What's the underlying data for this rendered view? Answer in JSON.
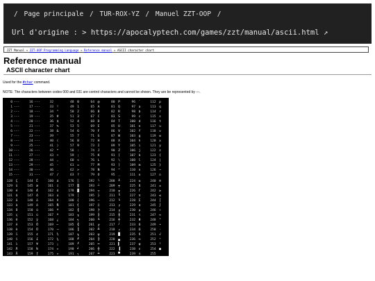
{
  "topbar": {
    "home": "Page principale",
    "sep": "/",
    "site": "TUR-ROX-YZ",
    "manual": "Manuel ZZT-OOP",
    "url_label": "Url d'origine :",
    "url_arrow": ">",
    "url": "https://apocalyptech.com/games/zzt/manual/ascii.html",
    "external_icon": "↗"
  },
  "breadcrumb": {
    "root": "ZZT Manual",
    "sep": "»",
    "lang": "ZZT-OOP Programming Language",
    "ref": "Reference manual",
    "current": "ASCII character chart"
  },
  "header": {
    "title": "Reference manual",
    "subtitle": "ASCII character chart"
  },
  "used": {
    "prefix": "Used for the",
    "command": "#char",
    "suffix": "command."
  },
  "note": "NOTE: The characters between codes 000 and 031 are control characters and cannot be shown. They are be represented by ---.",
  "chart": {
    "block1_columns": [
      [
        [
          "0",
          "---"
        ],
        [
          "1",
          "---"
        ],
        [
          "2",
          "---"
        ],
        [
          "3",
          "---"
        ],
        [
          "4",
          "---"
        ],
        [
          "5",
          "---"
        ],
        [
          "6",
          "---"
        ],
        [
          "7",
          "---"
        ],
        [
          "8",
          "---"
        ],
        [
          "9",
          "---"
        ],
        [
          "10",
          "---"
        ],
        [
          "11",
          "---"
        ],
        [
          "12",
          "---"
        ],
        [
          "13",
          "---"
        ],
        [
          "14",
          "---"
        ],
        [
          "15",
          "---"
        ]
      ],
      [
        [
          "16",
          "---"
        ],
        [
          "17",
          "---"
        ],
        [
          "18",
          "---"
        ],
        [
          "19",
          "---"
        ],
        [
          "20",
          "---"
        ],
        [
          "21",
          "---"
        ],
        [
          "22",
          "---"
        ],
        [
          "23",
          "---"
        ],
        [
          "24",
          "---"
        ],
        [
          "25",
          "---"
        ],
        [
          "26",
          "---"
        ],
        [
          "27",
          "---"
        ],
        [
          "28",
          "---"
        ],
        [
          "29",
          "---"
        ],
        [
          "30",
          "---"
        ],
        [
          "31",
          "---"
        ]
      ],
      [
        [
          "32",
          " "
        ],
        [
          "33",
          "!"
        ],
        [
          "34",
          "\""
        ],
        [
          "35",
          "#"
        ],
        [
          "36",
          "$"
        ],
        [
          "37",
          "%"
        ],
        [
          "38",
          "&"
        ],
        [
          "39",
          "'"
        ],
        [
          "40",
          "("
        ],
        [
          "41",
          ")"
        ],
        [
          "42",
          "*"
        ],
        [
          "43",
          "+"
        ],
        [
          "44",
          ","
        ],
        [
          "45",
          "-"
        ],
        [
          "46",
          "."
        ],
        [
          "47",
          "/"
        ]
      ],
      [
        [
          "48",
          "0"
        ],
        [
          "49",
          "1"
        ],
        [
          "50",
          "2"
        ],
        [
          "51",
          "3"
        ],
        [
          "52",
          "4"
        ],
        [
          "53",
          "5"
        ],
        [
          "54",
          "6"
        ],
        [
          "55",
          "7"
        ],
        [
          "56",
          "8"
        ],
        [
          "57",
          "9"
        ],
        [
          "58",
          ":"
        ],
        [
          "59",
          ";"
        ],
        [
          "60",
          "<"
        ],
        [
          "61",
          "="
        ],
        [
          "62",
          ">"
        ],
        [
          "63",
          "?"
        ]
      ],
      [
        [
          "64",
          "@"
        ],
        [
          "65",
          "A"
        ],
        [
          "66",
          "B"
        ],
        [
          "67",
          "C"
        ],
        [
          "68",
          "D"
        ],
        [
          "69",
          "E"
        ],
        [
          "70",
          "F"
        ],
        [
          "71",
          "G"
        ],
        [
          "72",
          "H"
        ],
        [
          "73",
          "I"
        ],
        [
          "74",
          "J"
        ],
        [
          "75",
          "K"
        ],
        [
          "76",
          "L"
        ],
        [
          "77",
          "M"
        ],
        [
          "78",
          "N"
        ],
        [
          "79",
          "O"
        ]
      ],
      [
        [
          "80",
          "P"
        ],
        [
          "81",
          "Q"
        ],
        [
          "82",
          "R"
        ],
        [
          "83",
          "S"
        ],
        [
          "84",
          "T"
        ],
        [
          "85",
          "U"
        ],
        [
          "86",
          "V"
        ],
        [
          "87",
          "W"
        ],
        [
          "88",
          "X"
        ],
        [
          "89",
          "Y"
        ],
        [
          "90",
          "Z"
        ],
        [
          "91",
          "["
        ],
        [
          "92",
          "\\"
        ],
        [
          "93",
          "]"
        ],
        [
          "94",
          "^"
        ],
        [
          "95",
          "_"
        ]
      ],
      [
        [
          "96",
          "`"
        ],
        [
          "97",
          "a"
        ],
        [
          "98",
          "b"
        ],
        [
          "99",
          "c"
        ],
        [
          "100",
          "d"
        ],
        [
          "101",
          "e"
        ],
        [
          "102",
          "f"
        ],
        [
          "103",
          "g"
        ],
        [
          "104",
          "h"
        ],
        [
          "105",
          "i"
        ],
        [
          "106",
          "j"
        ],
        [
          "107",
          "k"
        ],
        [
          "108",
          "l"
        ],
        [
          "109",
          "m"
        ],
        [
          "110",
          "n"
        ],
        [
          "111",
          "o"
        ]
      ],
      [
        [
          "112",
          "p"
        ],
        [
          "113",
          "q"
        ],
        [
          "114",
          "r"
        ],
        [
          "115",
          "s"
        ],
        [
          "116",
          "t"
        ],
        [
          "117",
          "u"
        ],
        [
          "118",
          "v"
        ],
        [
          "119",
          "w"
        ],
        [
          "120",
          "x"
        ],
        [
          "121",
          "y"
        ],
        [
          "122",
          "z"
        ],
        [
          "123",
          "{"
        ],
        [
          "124",
          "|"
        ],
        [
          "125",
          "}"
        ],
        [
          "126",
          "~"
        ],
        [
          "127",
          "⌂"
        ]
      ]
    ],
    "block2_columns": [
      [
        [
          "128",
          "Ç"
        ],
        [
          "129",
          "ü"
        ],
        [
          "130",
          "é"
        ],
        [
          "131",
          "â"
        ],
        [
          "132",
          "ä"
        ],
        [
          "133",
          "à"
        ],
        [
          "134",
          "å"
        ],
        [
          "135",
          "ç"
        ],
        [
          "136",
          "ê"
        ],
        [
          "137",
          "ë"
        ],
        [
          "138",
          "è"
        ],
        [
          "139",
          "ï"
        ],
        [
          "140",
          "î"
        ],
        [
          "141",
          "ì"
        ],
        [
          "142",
          "Ä"
        ],
        [
          "143",
          "Å"
        ]
      ],
      [
        [
          "144",
          "É"
        ],
        [
          "145",
          "æ"
        ],
        [
          "146",
          "Æ"
        ],
        [
          "147",
          "ô"
        ],
        [
          "148",
          "ö"
        ],
        [
          "149",
          "ò"
        ],
        [
          "150",
          "û"
        ],
        [
          "151",
          "ù"
        ],
        [
          "152",
          "ÿ"
        ],
        [
          "153",
          "Ö"
        ],
        [
          "154",
          "Ü"
        ],
        [
          "155",
          "¢"
        ],
        [
          "156",
          "£"
        ],
        [
          "157",
          "¥"
        ],
        [
          "158",
          "₧"
        ],
        [
          "159",
          "ƒ"
        ]
      ],
      [
        [
          "160",
          "á"
        ],
        [
          "161",
          "í"
        ],
        [
          "162",
          "ó"
        ],
        [
          "163",
          "ú"
        ],
        [
          "164",
          "ñ"
        ],
        [
          "165",
          "Ñ"
        ],
        [
          "166",
          "ª"
        ],
        [
          "167",
          "º"
        ],
        [
          "168",
          "¿"
        ],
        [
          "169",
          "⌐"
        ],
        [
          "170",
          "¬"
        ],
        [
          "171",
          "½"
        ],
        [
          "172",
          "¼"
        ],
        [
          "173",
          "¡"
        ],
        [
          "174",
          "«"
        ],
        [
          "175",
          "»"
        ]
      ],
      [
        [
          "176",
          "░"
        ],
        [
          "177",
          "▒"
        ],
        [
          "178",
          "▓"
        ],
        [
          "179",
          "│"
        ],
        [
          "180",
          "┤"
        ],
        [
          "181",
          "╡"
        ],
        [
          "182",
          "╢"
        ],
        [
          "183",
          "╖"
        ],
        [
          "184",
          "╕"
        ],
        [
          "185",
          "╣"
        ],
        [
          "186",
          "║"
        ],
        [
          "187",
          "╗"
        ],
        [
          "188",
          "╝"
        ],
        [
          "189",
          "╜"
        ],
        [
          "190",
          "╛"
        ],
        [
          "191",
          "┐"
        ]
      ],
      [
        [
          "192",
          "└"
        ],
        [
          "193",
          "┴"
        ],
        [
          "194",
          "┬"
        ],
        [
          "195",
          "├"
        ],
        [
          "196",
          "─"
        ],
        [
          "197",
          "┼"
        ],
        [
          "198",
          "╞"
        ],
        [
          "199",
          "╟"
        ],
        [
          "200",
          "╚"
        ],
        [
          "201",
          "╔"
        ],
        [
          "202",
          "╩"
        ],
        [
          "203",
          "╦"
        ],
        [
          "204",
          "╠"
        ],
        [
          "205",
          "═"
        ],
        [
          "206",
          "╬"
        ],
        [
          "207",
          "╧"
        ]
      ],
      [
        [
          "208",
          "╨"
        ],
        [
          "209",
          "╤"
        ],
        [
          "210",
          "╥"
        ],
        [
          "211",
          "╙"
        ],
        [
          "212",
          "╘"
        ],
        [
          "213",
          "╒"
        ],
        [
          "214",
          "╓"
        ],
        [
          "215",
          "╫"
        ],
        [
          "216",
          "╪"
        ],
        [
          "217",
          "┘"
        ],
        [
          "218",
          "┌"
        ],
        [
          "219",
          "█"
        ],
        [
          "220",
          "▄"
        ],
        [
          "221",
          "▌"
        ],
        [
          "222",
          "▐"
        ],
        [
          "223",
          "▀"
        ]
      ],
      [
        [
          "224",
          "α"
        ],
        [
          "225",
          "ß"
        ],
        [
          "226",
          "Γ"
        ],
        [
          "227",
          "π"
        ],
        [
          "228",
          "Σ"
        ],
        [
          "229",
          "σ"
        ],
        [
          "230",
          "µ"
        ],
        [
          "231",
          "τ"
        ],
        [
          "232",
          "Φ"
        ],
        [
          "233",
          "Θ"
        ],
        [
          "234",
          "Ω"
        ],
        [
          "235",
          "δ"
        ],
        [
          "236",
          "∞"
        ],
        [
          "237",
          "φ"
        ],
        [
          "238",
          "ε"
        ],
        [
          "239",
          "∩"
        ]
      ],
      [
        [
          "240",
          "≡"
        ],
        [
          "241",
          "±"
        ],
        [
          "242",
          "≥"
        ],
        [
          "243",
          "≤"
        ],
        [
          "244",
          "⌠"
        ],
        [
          "245",
          "⌡"
        ],
        [
          "246",
          "÷"
        ],
        [
          "247",
          "≈"
        ],
        [
          "248",
          "°"
        ],
        [
          "249",
          "∙"
        ],
        [
          "250",
          "·"
        ],
        [
          "251",
          "√"
        ],
        [
          "252",
          "ⁿ"
        ],
        [
          "253",
          "²"
        ],
        [
          "254",
          "■"
        ],
        [
          "255",
          " "
        ]
      ]
    ]
  }
}
